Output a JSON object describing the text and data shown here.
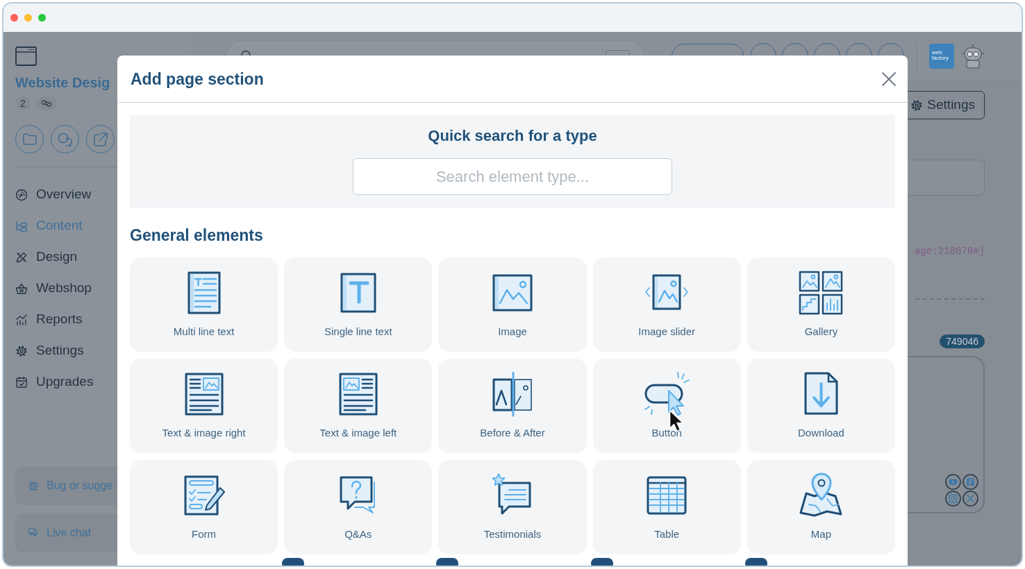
{
  "sidebar": {
    "site_name": "Website Desig",
    "page_count": "2",
    "nav": [
      {
        "label": "Overview",
        "kind": "overview",
        "selected": false
      },
      {
        "label": "Content",
        "kind": "content",
        "selected": true
      },
      {
        "label": "Design",
        "kind": "design",
        "selected": false
      },
      {
        "label": "Webshop",
        "kind": "webshop",
        "selected": false
      },
      {
        "label": "Reports",
        "kind": "reports",
        "selected": false
      },
      {
        "label": "Settings",
        "kind": "settings",
        "selected": false
      },
      {
        "label": "Upgrades",
        "kind": "upgrades",
        "selected": false
      }
    ],
    "help_links": [
      {
        "label": "Bug or sugge",
        "kind": "bug"
      },
      {
        "label": "Live chat",
        "kind": "chat"
      }
    ]
  },
  "topbar": {
    "logo_lines": [
      "web",
      "factory"
    ]
  },
  "page": {
    "settings_button": "Settings",
    "code_text": "age:218078#]",
    "id_badge": "749046"
  },
  "modal": {
    "title": "Add page section",
    "quick_search": {
      "title": "Quick search for a type",
      "placeholder": "Search element type..."
    },
    "section_title": "General elements",
    "elements": [
      {
        "label": "Multi line text",
        "kind": "multiline"
      },
      {
        "label": "Single line text",
        "kind": "singleline"
      },
      {
        "label": "Image",
        "kind": "image"
      },
      {
        "label": "Image slider",
        "kind": "slider"
      },
      {
        "label": "Gallery",
        "kind": "gallery"
      },
      {
        "label": "Text & image right",
        "kind": "textimageright"
      },
      {
        "label": "Text & image left",
        "kind": "textimageleft"
      },
      {
        "label": "Before & After",
        "kind": "beforeafter"
      },
      {
        "label": "Button",
        "kind": "button"
      },
      {
        "label": "Download",
        "kind": "download"
      },
      {
        "label": "Form",
        "kind": "form"
      },
      {
        "label": "Q&As",
        "kind": "qa"
      },
      {
        "label": "Testimonials",
        "kind": "testimonials"
      },
      {
        "label": "Table",
        "kind": "table"
      },
      {
        "label": "Map",
        "kind": "map"
      }
    ]
  }
}
